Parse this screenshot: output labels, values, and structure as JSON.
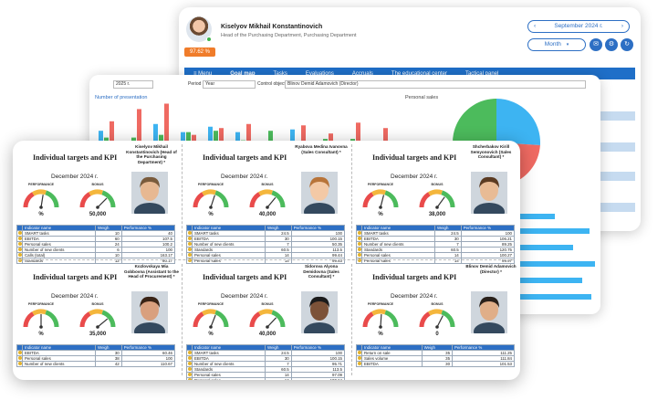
{
  "header": {
    "user_name": "Kiselyov Mikhail Konstantinovich",
    "user_dept": "Head of the Purchasing Department, Purchasing Department",
    "performance": "97.62 %",
    "date": "September 2024 г.",
    "period": "Month"
  },
  "nav": [
    "Menu",
    "Goal map",
    "Tasks",
    "Evaluations",
    "Accruals",
    "The educational center",
    "Tactical panel"
  ],
  "toolbar": {
    "year": "2025 г.",
    "period_label": "Period",
    "period_value": "Year",
    "control_label": "Control object",
    "control_value": "Blinov Demid Adamovich (Director)"
  },
  "charts": {
    "left_title": "Number of presentation",
    "right_title": "Personal sales"
  },
  "colors": {
    "blue": "#2d6fc4",
    "bar_cyan": "#3db4f2",
    "bar_green": "#4cbb5c",
    "bar_red": "#ef6a62",
    "orange": "#f07c2a"
  },
  "chart_data": [
    {
      "type": "bar",
      "title": "Number of presentation",
      "series": [
        {
          "values": [
            14,
            1,
            19,
            13,
            17,
            13,
            6,
            15,
            1,
            1,
            4
          ]
        },
        {
          "values": [
            9,
            9,
            11,
            13,
            14,
            7,
            14,
            6,
            8,
            8,
            2
          ]
        },
        {
          "values": [
            21,
            30,
            34,
            11,
            16,
            19,
            3,
            18,
            12,
            20,
            16
          ]
        }
      ]
    },
    {
      "type": "pie",
      "title": "Personal sales",
      "values": [
        26,
        39,
        35
      ]
    }
  ],
  "card_common": {
    "title": "Individual targets and KPI",
    "date": "December 2024 г.",
    "gauge_perf_label": "PERFORMANCE",
    "gauge_bonus_label": "BONUS",
    "col_name": "Indicator name",
    "col_weight": "Weigh",
    "col_perf": "Performance %"
  },
  "cards": [
    {
      "name": "Kiselyov Mikhail Konstantinovich (Head of the Purchasing Department) *",
      "perf_value": "%",
      "bonus_value": "50,000",
      "perf_level": 0.55,
      "bonus_level": 0.75,
      "rows": [
        [
          "SMART tasks",
          "10",
          "40"
        ],
        [
          "EBITDA",
          "60",
          "107.5"
        ],
        [
          "Personal sales",
          "24",
          "100.2"
        ],
        [
          "Number of new clients",
          "6",
          "100"
        ],
        [
          "Calls (total)",
          "10",
          "163.17"
        ],
        [
          "Standards",
          "12",
          "80.17"
        ]
      ]
    },
    {
      "name": "Ryabova Medina Ivanovna (Sales Consultant) *",
      "perf_value": "%",
      "bonus_value": "40,000",
      "perf_level": 0.6,
      "bonus_level": 0.72,
      "rows": [
        [
          "SMART tasks",
          "24.5",
          "100"
        ],
        [
          "EBITDA",
          "30",
          "100.15"
        ],
        [
          "Number of new clients",
          "7",
          "50.35"
        ],
        [
          "Standards",
          "60.5",
          "113.5"
        ],
        [
          "Personal sales",
          "14",
          "99.44"
        ],
        [
          "Personal sales",
          "14",
          "99.83"
        ]
      ]
    },
    {
      "name": "Shcherbakov Kirill Semyonovich (Sales Consultant) *",
      "perf_value": "%",
      "bonus_value": "38,000",
      "perf_level": 0.58,
      "bonus_level": 0.7,
      "rows": [
        [
          "SMART tasks",
          "24.5",
          "100"
        ],
        [
          "EBITDA",
          "30",
          "106.21"
        ],
        [
          "Number of new clients",
          "7",
          "89.25"
        ],
        [
          "Standards",
          "60.5",
          "120.75"
        ],
        [
          "Personal sales",
          "14",
          "100.27"
        ],
        [
          "Personal sales",
          "14",
          "99.97"
        ]
      ]
    },
    {
      "name": "Kozlovskaya Mia Gobbovna (Assistant to the Head of Procurement) *",
      "perf_value": "%",
      "bonus_value": "35,000",
      "perf_level": 0.5,
      "bonus_level": 0.78,
      "rows": [
        [
          "EBITDA",
          "30",
          "60.46"
        ],
        [
          "Personal sales",
          "38",
          "100"
        ],
        [
          "Number of new clients",
          "42",
          "110.67"
        ]
      ]
    },
    {
      "name": "Sidorova Alyona Demidovna (Sales Consultant) *",
      "perf_value": "%",
      "bonus_value": "40,000",
      "perf_level": 0.62,
      "bonus_level": 0.74,
      "rows": [
        [
          "SMART tasks",
          "24.5",
          "100"
        ],
        [
          "EBITDA",
          "30",
          "100.15"
        ],
        [
          "Number of new clients",
          "7",
          "95.71"
        ],
        [
          "Standards",
          "60.5",
          "113.5"
        ],
        [
          "Personal sales",
          "14",
          "97.09"
        ],
        [
          "Personal sales",
          "14",
          "100.64"
        ]
      ]
    },
    {
      "name": "Blinov Demid Adamovich (Director) *",
      "perf_value": "%",
      "bonus_value": "0",
      "perf_level": 0.52,
      "bonus_level": 0.65,
      "rows": [
        [
          "Return on sale",
          "35",
          "111.25"
        ],
        [
          "Sales volume",
          "35",
          "111.84"
        ],
        [
          "EBITDA",
          "30",
          "101.53"
        ]
      ]
    }
  ]
}
